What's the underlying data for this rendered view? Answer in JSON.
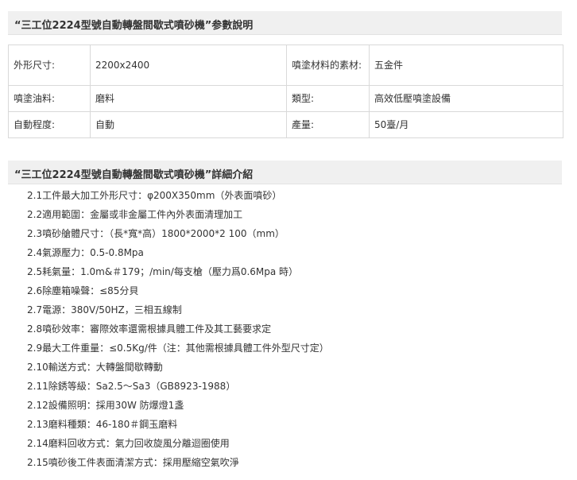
{
  "params_section": {
    "title": "“三工位2224型號自動轉盤間歇式噴砂機”参數說明",
    "rows": [
      [
        "外形尺寸:",
        "2200x2400",
        "噴塗材料的素材:",
        "五金件"
      ],
      [
        "噴塗油料:",
        "磨料",
        "類型:",
        "高效低壓噴塗設備"
      ],
      [
        "自動程度:",
        "自動",
        "產量:",
        "50臺/月"
      ]
    ]
  },
  "details_section": {
    "title": "“三工位2224型號自動轉盤間歇式噴砂機”詳細介紹",
    "items": [
      "2.1工件最大加工外形尺寸：φ200X350mm（外表面噴砂）",
      "2.2適用範圍：金屬或非金屬工件內外表面清理加工",
      "2.3噴砂艙體尺寸：（長*寬*高）1800*2000*2 100（mm）",
      "2.4氣源壓力：0.5-0.8Mpa",
      "2.5耗氣量：1.0m&＃179；/min/每支槍（壓力爲0.6Mpa 時）",
      "2.6除塵箱噪聲：≤85分貝",
      "2.7電源：380V/50HZ，三相五線制",
      "2.8噴砂效率：審際效率還需根據具體工件及其工藝要求定",
      "2.9最大工件重量：≤0.5Kg/件（注：其他需根據具體工件外型尺寸定）",
      "2.10輸送方式：大轉盤間歇轉動",
      "2.11除銹等級：Sa2.5～Sa3（GB8923-1988）",
      "2.12設備照明：採用30W 防爆燈1盞",
      "2.13磨料種類：46-180＃鋼玉磨料",
      "2.14磨料回收方式：氣力回收旋風分離迴圈使用",
      "2.15噴砂後工件表面清潔方式：採用壓縮空氣吹淨"
    ]
  }
}
